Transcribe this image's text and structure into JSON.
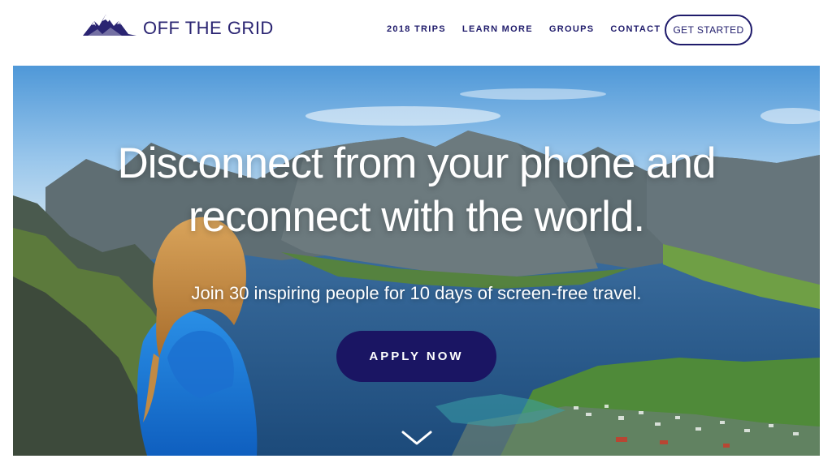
{
  "header": {
    "logo_text": "OFF THE GRID",
    "logo_icon": "mountain-logo-icon",
    "nav": [
      {
        "label": "2018 TRIPS"
      },
      {
        "label": "LEARN MORE"
      },
      {
        "label": "GROUPS"
      },
      {
        "label": "CONTACT"
      }
    ],
    "cta_label": "GET STARTED"
  },
  "hero": {
    "headline_line1": "Disconnect from your phone and",
    "headline_line2": "reconnect with the world.",
    "subheadline": "Join 30 inspiring people for 10 days of screen-free travel.",
    "apply_label": "APPLY NOW",
    "scroll_icon": "chevron-down-icon"
  },
  "colors": {
    "brand": "#1f1b6b",
    "button_fill": "#1a1563",
    "white": "#ffffff"
  }
}
